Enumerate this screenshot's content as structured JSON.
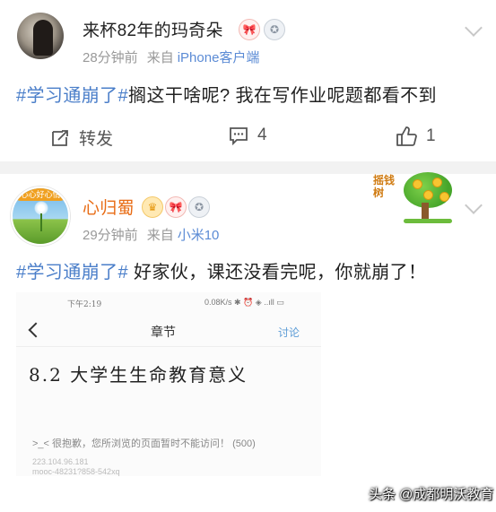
{
  "post1": {
    "username": "来杯82年的玛奇朵",
    "time": "28分钟前",
    "source_prefix": "来自",
    "source": "iPhone客户端",
    "hashtag": "#学习通崩了#",
    "content": "搁这干啥呢? 我在写作业呢题都看不到",
    "repost_label": "转发",
    "comment_count": "4",
    "like_count": "1"
  },
  "post2": {
    "username": "心归蜀",
    "time": "29分钟前",
    "source_prefix": "来自",
    "source": "小米10",
    "hashtag": "#学习通崩了#",
    "content": " 好家伙，课还没看完呢，你就崩了！",
    "sticker_text": "摇钱树",
    "avatar_tag": "心心好心情",
    "screenshot": {
      "status_time": "下午2:19",
      "status_right": "0.08K/s ✱ ⏰ ◈ ..ıll ▭",
      "nav_title": "章节",
      "nav_discuss": "讨论",
      "chapter": "8.2 大学生生命教育意义",
      "error": ">_< 很抱歉，您所浏览的页面暂时不能访问！ (500)",
      "ip": "223.104.96.181",
      "host": "mooc-48231?858-542xq"
    }
  },
  "watermark": "头条 @成都明沃教育",
  "colors": {
    "link": "#4a7ec9",
    "meta": "#999999",
    "name_highlight": "#e86c15",
    "separator": "#f2f2f2"
  }
}
